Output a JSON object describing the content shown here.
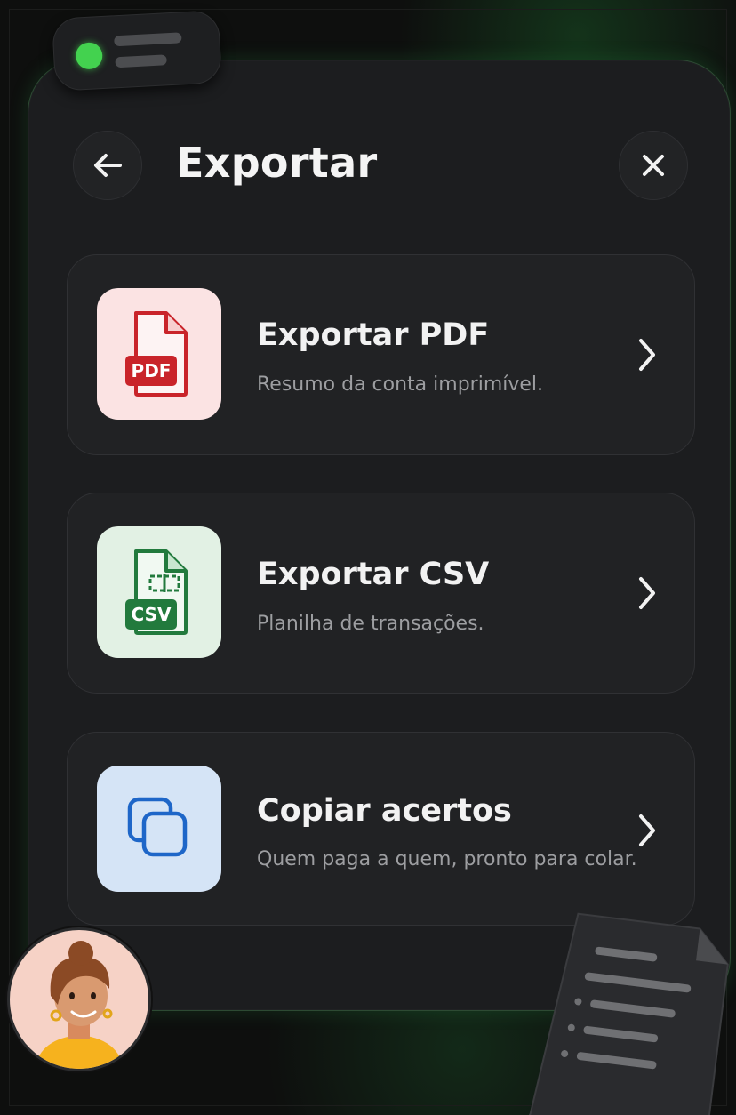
{
  "header": {
    "title": "Exportar",
    "back_icon": "arrow-left-icon",
    "close_icon": "close-icon"
  },
  "options": [
    {
      "title": "Exportar PDF",
      "subtitle": "Resumo da conta imprimível.",
      "icon": "pdf-file-icon",
      "badge": "PDF",
      "tile_color": "#fbe3e3",
      "accent_color": "#c9242a"
    },
    {
      "title": "Exportar CSV",
      "subtitle": "Planilha de transações.",
      "icon": "csv-file-icon",
      "badge": "CSV",
      "tile_color": "#e2f1e4",
      "accent_color": "#227a3d"
    },
    {
      "title": "Copiar acertos",
      "subtitle": "Quem paga a quem, pronto para colar.",
      "icon": "copy-icon",
      "tile_color": "#d5e4f6",
      "accent_color": "#1e66c8"
    }
  ],
  "status_indicator": {
    "color": "#43d24f",
    "icon": "online-status-dot"
  },
  "decor": {
    "avatar": "user-avatar",
    "document": "document-illustration-icon"
  }
}
